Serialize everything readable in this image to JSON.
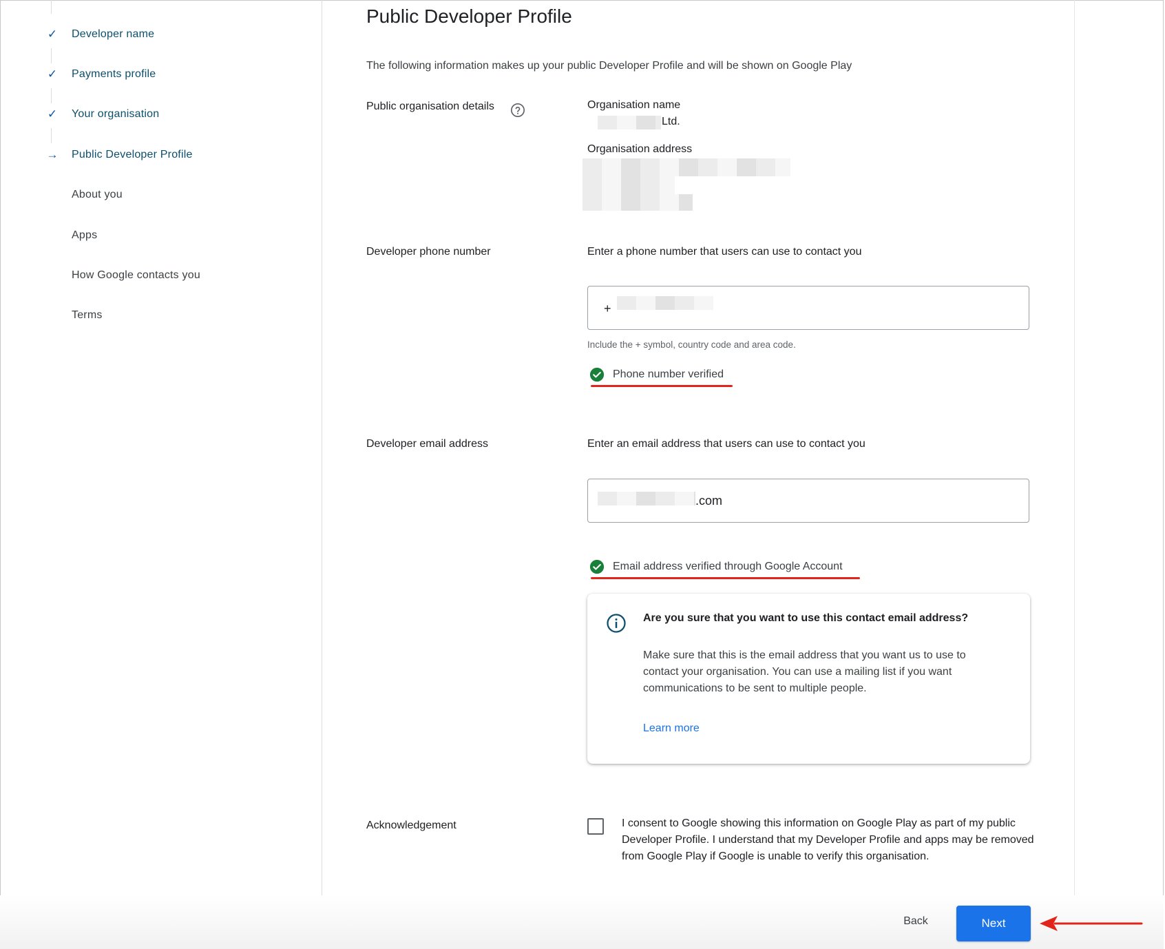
{
  "sidebar": {
    "steps": [
      {
        "label": "Developer name",
        "state": "done"
      },
      {
        "label": "Payments profile",
        "state": "done"
      },
      {
        "label": "Your organisation",
        "state": "done"
      },
      {
        "label": "Public Developer Profile",
        "state": "current"
      },
      {
        "label": "About you",
        "state": "todo"
      },
      {
        "label": "Apps",
        "state": "todo"
      },
      {
        "label": "How Google contacts you",
        "state": "todo"
      },
      {
        "label": "Terms",
        "state": "todo"
      }
    ],
    "done_mark": "✓",
    "current_mark": "→"
  },
  "main": {
    "title": "Public Developer Profile",
    "intro": "The following information makes up your public Developer Profile and will be shown on Google Play",
    "org_details": {
      "label": "Public organisation details",
      "name_label": "Organisation name",
      "name_value_suffix": "Ltd.",
      "address_label": "Organisation address"
    },
    "phone": {
      "label": "Developer phone number",
      "prompt": "Enter a phone number that users can use to contact you",
      "value_prefix": "+",
      "hint": "Include the + symbol, country code and area code.",
      "verified_text": "Phone number verified"
    },
    "email": {
      "label": "Developer email address",
      "prompt": "Enter an email address that users can use to contact you",
      "value_suffix": ".com",
      "verified_text": "Email address verified through Google Account"
    },
    "info_card": {
      "title": "Are you sure that you want to use this contact email address?",
      "body": "Make sure that this is the email address that you want us to use to contact your organisation. You can use a mailing list if you want communications to be sent to multiple people.",
      "link": "Learn more"
    },
    "acknowledgement": {
      "label": "Acknowledgement",
      "text": "I consent to Google showing this information on Google Play as part of my public Developer Profile. I understand that my Developer Profile and apps may be removed from Google Play if Google is unable to verify this organisation.",
      "checked": false
    }
  },
  "footer": {
    "back_label": "Back",
    "next_label": "Next"
  },
  "colors": {
    "accent": "#1a73e8",
    "verified_green": "#188038",
    "annotation_red": "#e1251b"
  }
}
